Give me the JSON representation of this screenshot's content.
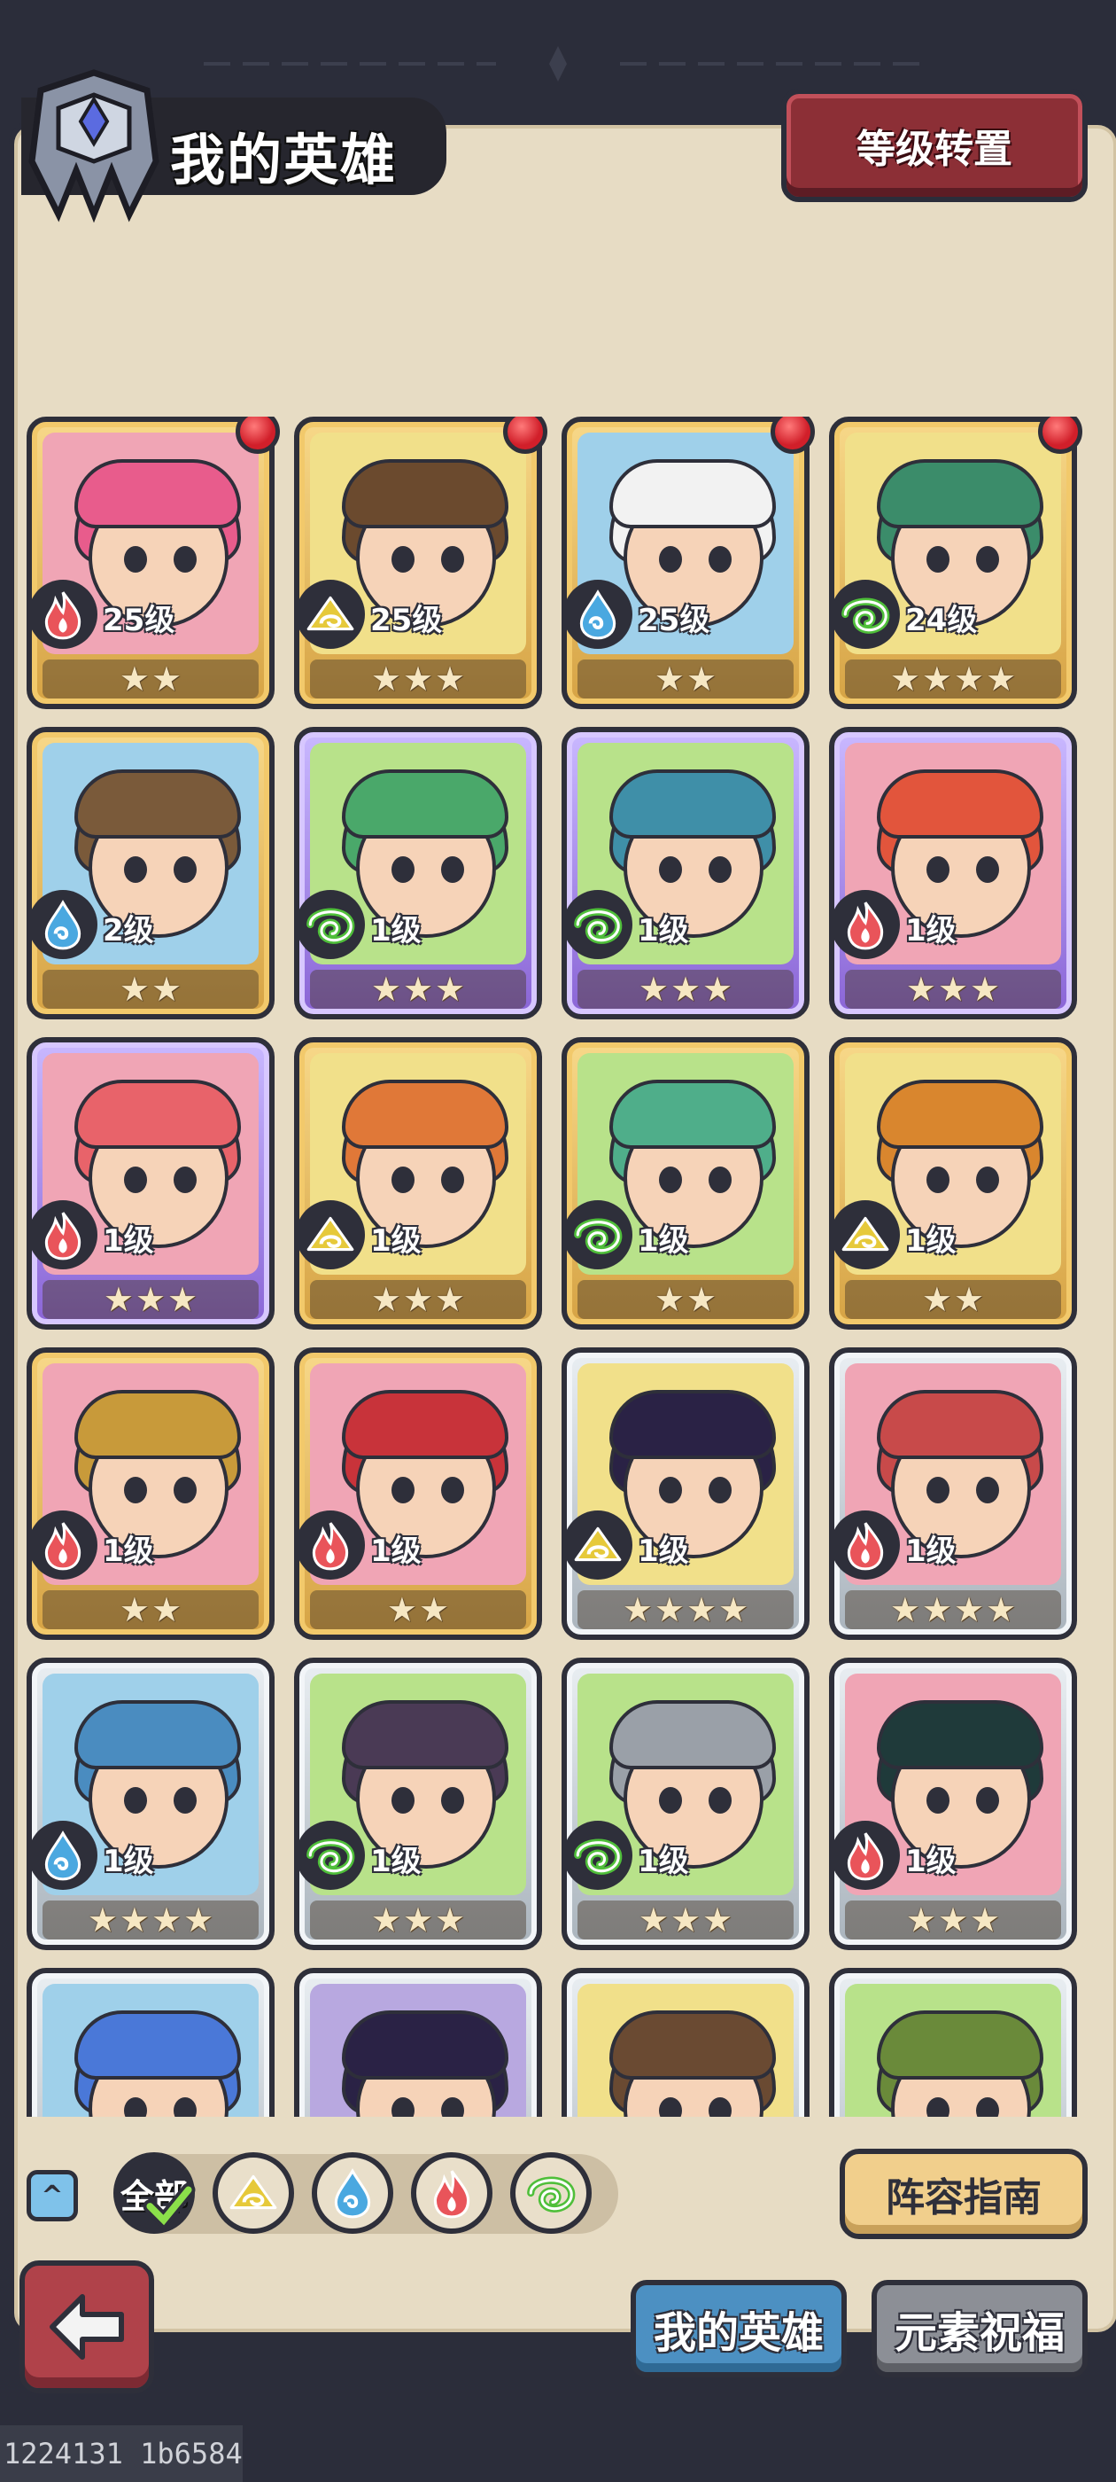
{
  "header": {
    "title": "我的英雄",
    "transfer_label": "等级转置"
  },
  "heroes": [
    {
      "level": "25级",
      "stars": 2,
      "element": "fire",
      "frame": "gold",
      "hair": "#e85c8c",
      "bg": "#f0a5b5",
      "badge": true
    },
    {
      "level": "25级",
      "stars": 3,
      "element": "earth",
      "frame": "gold",
      "hair": "#6b4a2e",
      "bg": "#f1e08a",
      "badge": true
    },
    {
      "level": "25级",
      "stars": 2,
      "element": "water",
      "frame": "gold",
      "hair": "#f2f2f2",
      "bg": "#9fd0ea",
      "badge": true
    },
    {
      "level": "24级",
      "stars": 4,
      "element": "wind",
      "frame": "gold",
      "hair": "#3b8c6a",
      "bg": "#f1e08a",
      "badge": true
    },
    {
      "level": "2级",
      "stars": 2,
      "element": "water",
      "frame": "gold",
      "hair": "#7a5a3a",
      "bg": "#9fd0ea",
      "badge": false
    },
    {
      "level": "1级",
      "stars": 3,
      "element": "wind",
      "frame": "purple",
      "hair": "#4aa86a",
      "bg": "#b8e28a",
      "badge": false
    },
    {
      "level": "1级",
      "stars": 3,
      "element": "wind",
      "frame": "purple",
      "hair": "#3f8fa8",
      "bg": "#b8e28a",
      "badge": false
    },
    {
      "level": "1级",
      "stars": 3,
      "element": "fire",
      "frame": "purple",
      "hair": "#e2553c",
      "bg": "#f0a5b5",
      "badge": false
    },
    {
      "level": "1级",
      "stars": 3,
      "element": "fire",
      "frame": "purple",
      "hair": "#e8636a",
      "bg": "#f0a5b5",
      "badge": false
    },
    {
      "level": "1级",
      "stars": 3,
      "element": "earth",
      "frame": "gold",
      "hair": "#e07838",
      "bg": "#f1e08a",
      "badge": false
    },
    {
      "level": "1级",
      "stars": 2,
      "element": "wind",
      "frame": "gold",
      "hair": "#4fae8a",
      "bg": "#b8e28a",
      "badge": false
    },
    {
      "level": "1级",
      "stars": 2,
      "element": "earth",
      "frame": "gold",
      "hair": "#d9862e",
      "bg": "#f1e08a",
      "badge": false
    },
    {
      "level": "1级",
      "stars": 2,
      "element": "fire",
      "frame": "gold",
      "hair": "#c89a3a",
      "bg": "#f0a5b5",
      "badge": false
    },
    {
      "level": "1级",
      "stars": 2,
      "element": "fire",
      "frame": "gold",
      "hair": "#c8333a",
      "bg": "#f0a5b5",
      "badge": false
    },
    {
      "level": "1级",
      "stars": 4,
      "element": "earth",
      "frame": "silver",
      "hair": "#2a2245",
      "bg": "#f1e08a",
      "badge": false
    },
    {
      "level": "1级",
      "stars": 4,
      "element": "fire",
      "frame": "silver",
      "hair": "#c84a4a",
      "bg": "#f0a5b5",
      "badge": false
    },
    {
      "level": "1级",
      "stars": 4,
      "element": "water",
      "frame": "silver",
      "hair": "#4a8cc0",
      "bg": "#9fd0ea",
      "badge": false
    },
    {
      "level": "1级",
      "stars": 3,
      "element": "wind",
      "frame": "silver",
      "hair": "#4a3a55",
      "bg": "#b8e28a",
      "badge": false
    },
    {
      "level": "1级",
      "stars": 3,
      "element": "wind",
      "frame": "silver",
      "hair": "#9aa0a8",
      "bg": "#b8e28a",
      "badge": false
    },
    {
      "level": "1级",
      "stars": 3,
      "element": "fire",
      "frame": "silver",
      "hair": "#1f3a3a",
      "bg": "#f0a5b5",
      "badge": false
    },
    {
      "level": "",
      "stars": 0,
      "element": "",
      "frame": "silver",
      "hair": "#4a78d8",
      "bg": "#9fd0ea",
      "badge": false
    },
    {
      "level": "",
      "stars": 0,
      "element": "",
      "frame": "silver",
      "hair": "#2a2245",
      "bg": "#b8a8e0",
      "badge": false
    },
    {
      "level": "",
      "stars": 0,
      "element": "",
      "frame": "silver",
      "hair": "#6a4a32",
      "bg": "#f1e08a",
      "badge": false
    },
    {
      "level": "",
      "stars": 0,
      "element": "",
      "frame": "silver",
      "hair": "#6a8a3a",
      "bg": "#b8e28a",
      "badge": false
    }
  ],
  "filters": {
    "all_label": "全部",
    "elements": [
      "earth",
      "water",
      "fire",
      "wind"
    ]
  },
  "element_colors": {
    "fire": "#e9545a",
    "earth": "#e6c93a",
    "water": "#4aa8e0",
    "wind": "#4fbf3a"
  },
  "guide_label": "阵容指南",
  "tabs": {
    "my_heroes": "我的英雄",
    "element_blessing": "元素祝福"
  },
  "debug_text": "1224131 1b6584"
}
